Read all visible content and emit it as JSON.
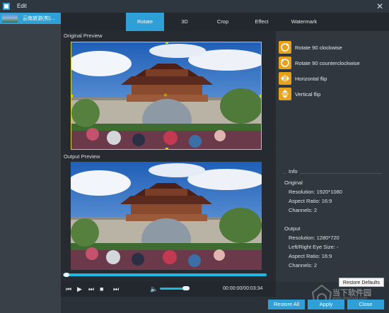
{
  "window": {
    "title": "Edit",
    "close_glyph": "✕"
  },
  "sidebar": {
    "items": [
      {
        "label": "云南旅游(剪)..."
      }
    ]
  },
  "tabs": [
    {
      "label": "Rotate",
      "active": true
    },
    {
      "label": "3D",
      "active": false
    },
    {
      "label": "Crop",
      "active": false
    },
    {
      "label": "Effect",
      "active": false
    },
    {
      "label": "Watermark",
      "active": false
    }
  ],
  "preview": {
    "original_label": "Original Preview",
    "output_label": "Output Preview"
  },
  "rotate": {
    "options": [
      {
        "label": "Rotate 90 clockwise",
        "icon": "rotate-cw-icon"
      },
      {
        "label": "Rotate 90 counterclockwise",
        "icon": "rotate-ccw-icon"
      },
      {
        "label": "Horizontal flip",
        "icon": "flip-horizontal-icon"
      },
      {
        "label": "Vertical flip",
        "icon": "flip-vertical-icon"
      }
    ]
  },
  "info": {
    "title": "Info",
    "original_heading": "Original",
    "original_resolution": "Resolution: 1920*1080",
    "original_aspect": "Aspect Ratio: 16:9",
    "original_channels": "Channels: 2",
    "output_heading": "Output",
    "output_resolution": "Resolution: 1280*720",
    "output_eye_size": "Left/Right Eye Size: -",
    "output_aspect": "Aspect Ratio: 16:9",
    "output_channels": "Channels: 2"
  },
  "player": {
    "timecode": "00:00:00/00:03:34",
    "progress": 0.02,
    "volume": 0.75
  },
  "buttons": {
    "restore_defaults": "Restore Defaults",
    "restore_all": "Restore All",
    "apply": "Apply",
    "close": "Close"
  },
  "watermark": {
    "text": "当下软件园",
    "sub": "www.downxia.com"
  },
  "colors": {
    "accent": "#2e9fd7",
    "rotate_button": "#e8a11b",
    "crop_frame": "#d8d600"
  }
}
